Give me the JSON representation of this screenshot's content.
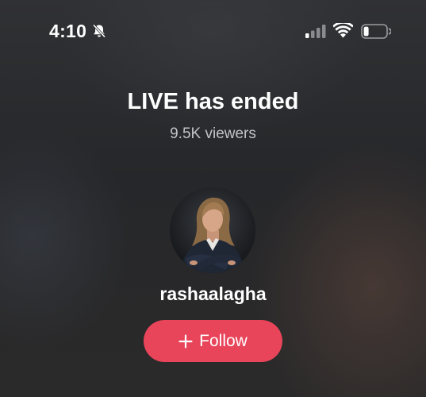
{
  "status_bar": {
    "time": "4:10",
    "icons": [
      "bell-slash-icon",
      "cellular-signal-icon",
      "wifi-icon",
      "battery-icon"
    ]
  },
  "live": {
    "title": "LIVE has ended",
    "viewers": "9.5K viewers"
  },
  "profile": {
    "username": "rashaalagha",
    "avatar": "avatar"
  },
  "actions": {
    "follow_label": "Follow",
    "follow_icon": "plus-icon"
  },
  "colors": {
    "follow_button": "#e8445a",
    "background": "#2a2b2d",
    "secondary_text": "#c2c3c6"
  }
}
